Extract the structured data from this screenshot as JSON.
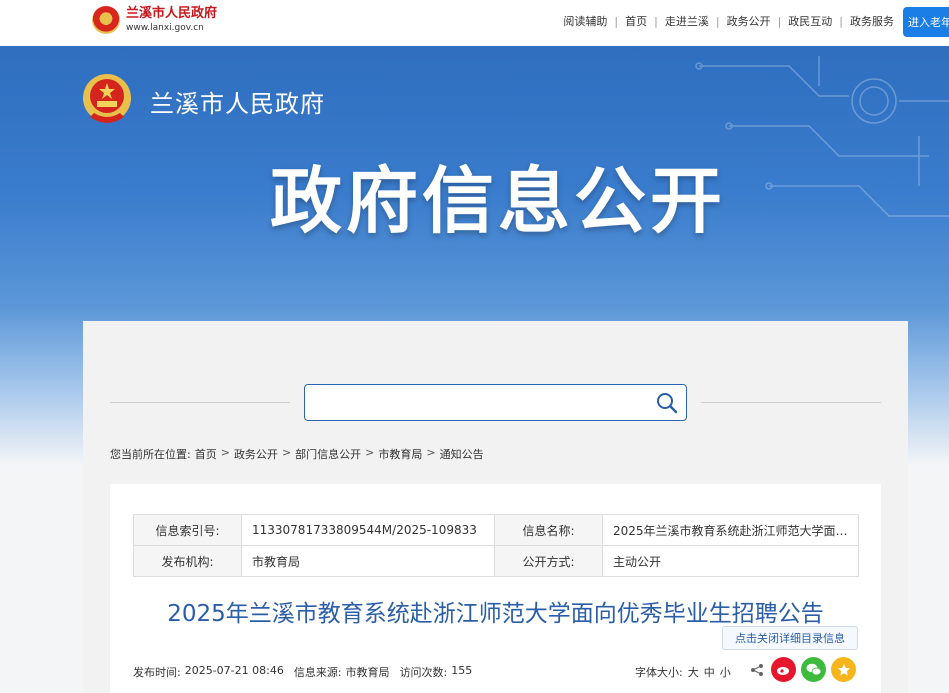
{
  "header": {
    "site_name": "兰溪市人民政府",
    "site_url": "www.lanxi.gov.cn",
    "nav": [
      "阅读辅助",
      "首页",
      "走进兰溪",
      "政务公开",
      "政民互动",
      "政务服务"
    ],
    "elder_mode": "进入老年"
  },
  "banner": {
    "site_name": "兰溪市人民政府",
    "title": "政府信息公开"
  },
  "search": {
    "placeholder": ""
  },
  "breadcrumb": {
    "prefix": "您当前所在位置:",
    "items": [
      "首页",
      "政务公开",
      "部门信息公开",
      "市教育局",
      "通知公告"
    ]
  },
  "meta": {
    "index_label": "信息索引号:",
    "index_value": "11330781733809544M/2025-109833",
    "name_label": "信息名称:",
    "name_value": "2025年兰溪市教育系统赴浙江师范大学面…",
    "org_label": "发布机构:",
    "org_value": "市教育局",
    "mode_label": "公开方式:",
    "mode_value": "主动公开"
  },
  "article": {
    "title": "2025年兰溪市教育系统赴浙江师范大学面向优秀毕业生招聘公告",
    "toggle_label": "点击关闭详细目录信息",
    "publish_label": "发布时间:",
    "publish_time": "2025-07-21 08:46",
    "source_label": "信息来源:",
    "source": "市教育局",
    "visits_label": "访问次数:",
    "visits": "155",
    "font_size_label": "字体大小:",
    "font_sizes": [
      "大",
      "中",
      "小"
    ]
  },
  "colors": {
    "brand_red": "#c8161d",
    "accent_blue": "#1a7ee6",
    "title_blue": "#2a5ea7"
  }
}
